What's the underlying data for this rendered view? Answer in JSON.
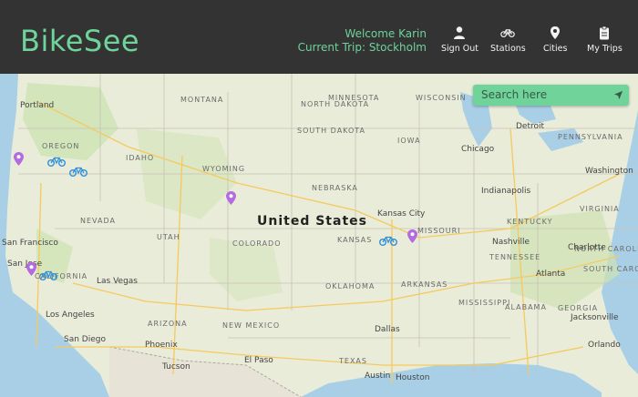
{
  "app": {
    "logo": "BikeSee"
  },
  "header": {
    "welcome": "Welcome Karin",
    "current_trip": "Current Trip: Stockholm",
    "nav": [
      {
        "label": "Sign Out",
        "icon": "user-icon"
      },
      {
        "label": "Stations",
        "icon": "bike-icon"
      },
      {
        "label": "Cities",
        "icon": "pin-icon"
      },
      {
        "label": "My Trips",
        "icon": "clipboard-icon"
      }
    ]
  },
  "search": {
    "placeholder": "Search here"
  },
  "map": {
    "country": "United States",
    "states": [
      "MINNESOTA",
      "OREGON",
      "IDAHO",
      "WYOMING",
      "SOUTH DAKOTA",
      "NORTH DAKOTA",
      "MONTANA",
      "NEBRASKA",
      "IOWA",
      "NEVADA",
      "UTAH",
      "COLORADO",
      "KANSAS",
      "MISSOURI",
      "KENTUCKY",
      "TENNESSEE",
      "OKLAHOMA",
      "ARKANSAS",
      "MISSISSIPPI",
      "ALABAMA",
      "GEORGIA",
      "ARIZONA",
      "NEW MEXICO",
      "TEXAS",
      "CALIFORNIA",
      "SOUTH CAROLINA",
      "NORTH CAROLINA",
      "VIRGINIA",
      "PENNSYLVANIA",
      "WISCONSIN"
    ],
    "cities": [
      "Portland",
      "Chicago",
      "Detroit",
      "Washington",
      "Indianapolis",
      "Kansas City",
      "Nashville",
      "Charlotte",
      "Atlanta",
      "Jacksonville",
      "Orlando",
      "Dallas",
      "Austin",
      "Houston",
      "El Paso",
      "Phoenix",
      "Tucson",
      "San Diego",
      "Los Angeles",
      "Las Vegas",
      "San Jose",
      "San Francisco"
    ],
    "colors": {
      "marker": "#b36be0",
      "bike": "#2f8fd8",
      "accent": "#6fd39a"
    }
  }
}
